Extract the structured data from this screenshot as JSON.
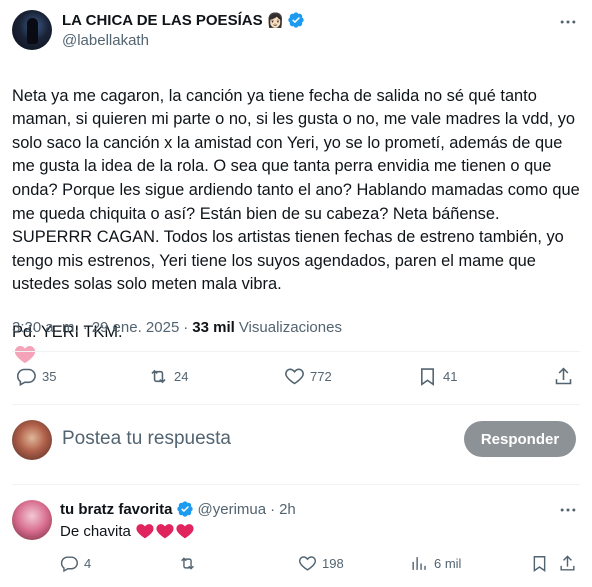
{
  "author": {
    "name": "LA CHICA DE LAS POESÍAS",
    "emoji": "👩🏻",
    "handle": "@labellakath"
  },
  "tweet": {
    "text": "Neta ya me cagaron, la canción ya tiene fecha de salida no sé qué tanto maman, si quieren mi parte o no, si les gusta o no, me vale madres la vdd, yo solo saco la canción x la amistad con Yeri, yo se lo prometí, además de que me gusta la idea de la rola. O sea que tanta perra envidia me tienen o que onda? Porque les sigue ardiendo tanto el ano? Hablando mamadas como que me queda chiquita o así? Están bien de su cabeza? Neta báñense. SUPERRR CAGAN. Todos los artistas tienen fechas de estreno también, yo tengo mis estrenos, Yeri tiene los suyos agendados, paren el mame que ustedes solas solo meten mala vibra.",
    "ps": "Pd: YERI TKM.",
    "time": "3:20 a. m.",
    "separator": "·",
    "date": "29 ene. 2025",
    "views_count": "33 mil",
    "views_label": "Visualizaciones"
  },
  "actions": {
    "replies": "35",
    "reposts": "24",
    "likes": "772",
    "bookmarks": "41"
  },
  "reply_composer": {
    "placeholder": "Postea tu respuesta",
    "button": "Responder"
  },
  "reply": {
    "name": "tu bratz favorita",
    "handle": "@yerimua",
    "dot": "·",
    "time": "2h",
    "text": "De chavita",
    "replies": "4",
    "likes": "198",
    "views": "6 mil"
  },
  "colors": {
    "verified": "#1d9bf0",
    "text_primary": "#0f1419",
    "text_secondary": "#536471",
    "reply_button": "#8d9296",
    "heart_pink": "#f4a3b8",
    "heart_red": "#e0245e"
  }
}
